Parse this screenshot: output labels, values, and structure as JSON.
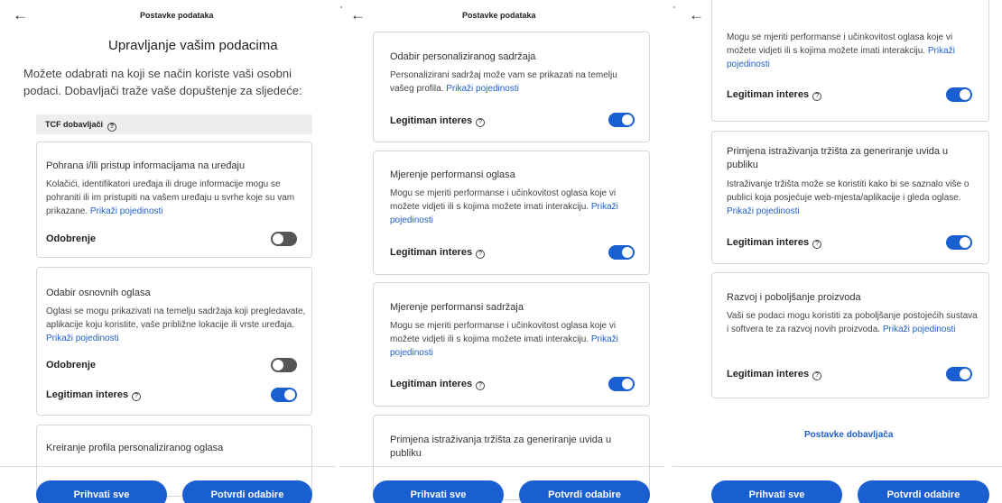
{
  "topbar": {
    "back_icon": "arrow-left-icon",
    "title": "Postavke podataka"
  },
  "panel1": {
    "heading": "Upravljanje vašim podacima",
    "intro": "Možete odabrati na koji se način koriste vaši osobni podaci. Dobavljači traže vaše dopuštenje za sljedeće:",
    "tcf_label": "TCF dobavljači",
    "cards": [
      {
        "title": "Pohrana i/ili pristup informacijama na uređaju",
        "description": "Kolačići, identifikatori uređaja ili druge informacije mogu se pohraniti ili im pristupiti na vašem uređaju u svrhe koje su vam prikazane.",
        "link": "Prikaži pojedinosti",
        "rows": [
          {
            "label": "Odobrenje",
            "state": "off"
          }
        ]
      },
      {
        "title": "Odabir osnovnih oglasa",
        "description": "Oglasi se mogu prikazivati na temelju sadržaja koji pregledavate, aplikacije koju koristite, vaše približne lokacije ili vrste uređaja.",
        "link": "Prikaži pojedinosti",
        "rows": [
          {
            "label": "Odobrenje",
            "state": "off"
          },
          {
            "label": "Legitiman interes",
            "state": "on"
          }
        ]
      },
      {
        "title": "Kreiranje profila personaliziranog oglasa"
      }
    ]
  },
  "panel2": {
    "cards": [
      {
        "title": "Odabir personaliziranog sadržaja",
        "description": "Personalizirani sadržaj može vam se prikazati na temelju vašeg profila.",
        "link": "Prikaži pojedinosti",
        "rows": [
          {
            "label": "Legitiman interes",
            "state": "on"
          }
        ]
      },
      {
        "title": "Mjerenje performansi oglasa",
        "description": "Mogu se mjeriti performanse i učinkovitost oglasa koje vi možete vidjeti ili s kojima možete imati interakciju.",
        "link": "Prikaži pojedinosti",
        "rows": [
          {
            "label": "Legitiman interes",
            "state": "on"
          }
        ]
      },
      {
        "title": "Mjerenje performansi sadržaja",
        "description": "Mogu se mjeriti performanse i učinkovitost oglasa koje vi možete vidjeti ili s kojima možete imati interakciju.",
        "link": "Prikaži pojedinosti",
        "rows": [
          {
            "label": "Legitiman interes",
            "state": "on"
          }
        ]
      },
      {
        "title": "Primjena istraživanja tržišta za generiranje uvida u publiku"
      }
    ]
  },
  "panel3": {
    "cards": [
      {
        "description": "Mogu se mjeriti performanse i učinkovitost oglasa koje vi možete vidjeti ili s kojima možete imati interakciju.",
        "link": "Prikaži pojedinosti",
        "rows": [
          {
            "label": "Legitiman interes",
            "state": "on"
          }
        ]
      },
      {
        "title": "Primjena istraživanja tržišta za generiranje uvida u publiku",
        "description": "Istraživanje tržišta može se koristiti kako bi se saznalo više o publici koja posjećuje web-mjesta/aplikacije i gleda oglase.",
        "link": "Prikaži pojedinosti",
        "rows": [
          {
            "label": "Legitiman interes",
            "state": "on"
          }
        ]
      },
      {
        "title": "Razvoj i poboljšanje proizvoda",
        "description": "Vaši se podaci mogu koristiti za poboljšanje postojećih sustava i softvera te za razvoj novih proizvoda.",
        "link": "Prikaži pojedinosti",
        "rows": [
          {
            "label": "Legitiman interes",
            "state": "on"
          }
        ]
      }
    ],
    "vendor_link": "Postavke dobavljača"
  },
  "footer": {
    "accept_all": "Prihvati sve",
    "confirm": "Potvrdi odabire"
  },
  "colors": {
    "accent": "#1a5fd1",
    "link": "#1f5fc9",
    "toggle_off": "#555555"
  },
  "icons": {
    "help": "question-circle-icon",
    "back": "arrow-left-icon"
  }
}
